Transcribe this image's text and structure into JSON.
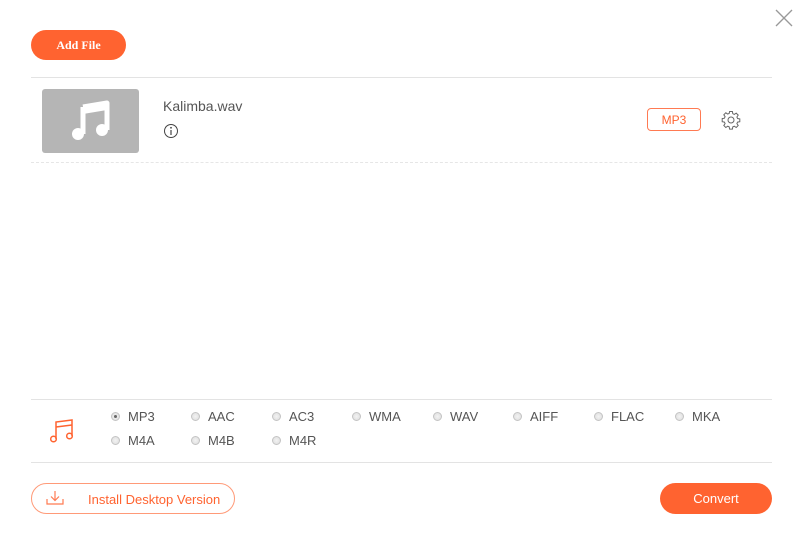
{
  "header": {
    "add_file_label": "Add File",
    "close_icon": "close-icon"
  },
  "files": [
    {
      "name": "Kalimba.wav",
      "thumbnail_icon": "music-note-icon",
      "info_icon": "info-icon",
      "output_format": "MP3",
      "settings_icon": "gear-icon"
    }
  ],
  "formats": {
    "icon": "music-note-icon",
    "selected": "MP3",
    "options": [
      "MP3",
      "AAC",
      "AC3",
      "WMA",
      "WAV",
      "AIFF",
      "FLAC",
      "MKA",
      "M4A",
      "M4B",
      "M4R"
    ]
  },
  "footer": {
    "install_label": "Install Desktop Version",
    "install_icon": "download-icon",
    "convert_label": "Convert"
  },
  "colors": {
    "accent": "#ff6330",
    "thumbnail_bg": "#b5b5b5"
  }
}
